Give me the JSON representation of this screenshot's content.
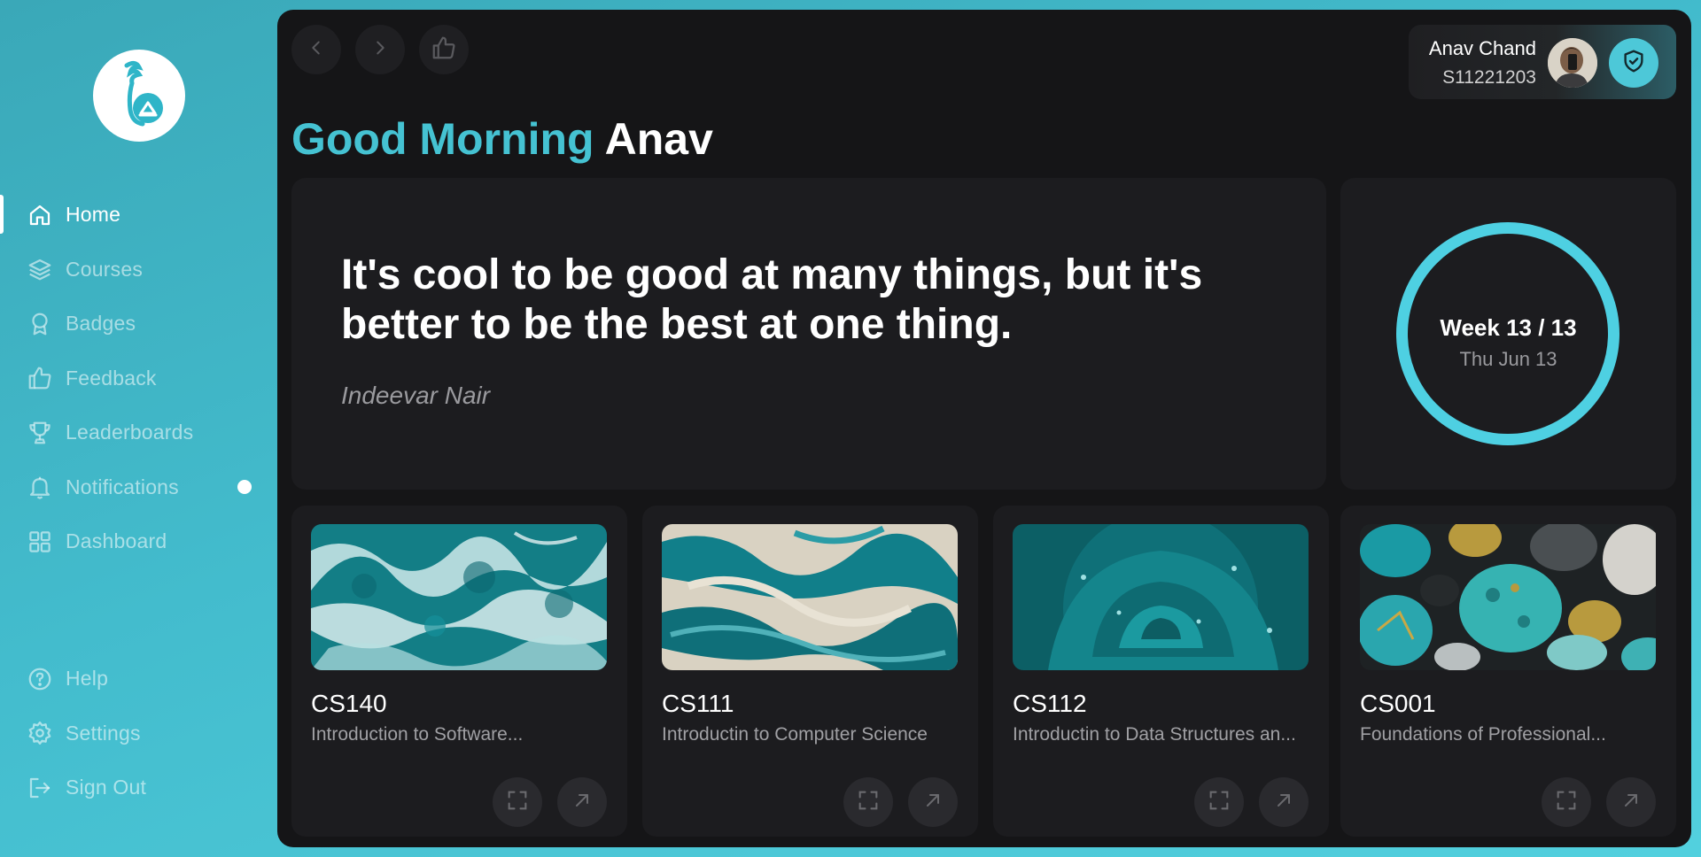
{
  "theme": {
    "accent": "#45c2d2",
    "panel": "#151517",
    "card": "#1c1c1f"
  },
  "sidebar": {
    "items": [
      {
        "label": "Home",
        "icon": "home-icon",
        "active": true
      },
      {
        "label": "Courses",
        "icon": "layers-icon"
      },
      {
        "label": "Badges",
        "icon": "badge-icon"
      },
      {
        "label": "Feedback",
        "icon": "thumbs-up-icon"
      },
      {
        "label": "Leaderboards",
        "icon": "trophy-icon"
      },
      {
        "label": "Notifications",
        "icon": "bell-icon",
        "has_unread": true
      },
      {
        "label": "Dashboard",
        "icon": "grid-icon"
      }
    ],
    "bottom_items": [
      {
        "label": "Help",
        "icon": "help-icon"
      },
      {
        "label": "Settings",
        "icon": "gear-icon"
      },
      {
        "label": "Sign Out",
        "icon": "sign-out-icon"
      }
    ]
  },
  "header": {
    "user_name": "Anav Chand",
    "user_id": "S11221203"
  },
  "greeting": {
    "prefix": "Good Morning",
    "name": "Anav"
  },
  "quote": {
    "text": "It's cool to be good at many things, but it's better to be the best at one thing.",
    "author": "Indeevar Nair"
  },
  "week": {
    "title": "Week 13 / 13",
    "date": "Thu Jun 13"
  },
  "courses": [
    {
      "code": "CS140",
      "name": "Introduction to Software..."
    },
    {
      "code": "CS111",
      "name": "Introductin to Computer Science"
    },
    {
      "code": "CS112",
      "name": "Introductin to Data Structures an..."
    },
    {
      "code": "CS001",
      "name": "Foundations of Professional..."
    }
  ]
}
